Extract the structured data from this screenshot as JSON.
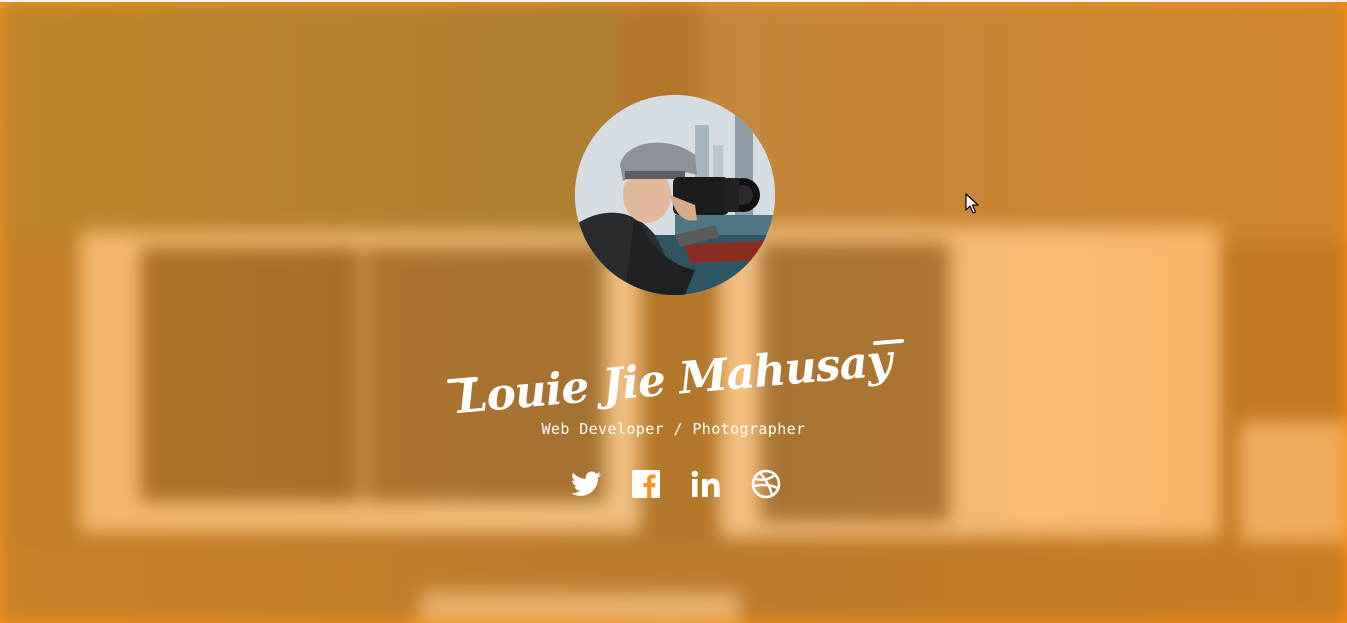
{
  "profile": {
    "name": "Louie Jie Mahusay",
    "subtitle": "Web Developer / Photographer",
    "avatar_icon": "photographer-portrait"
  },
  "social": [
    {
      "icon": "twitter-icon"
    },
    {
      "icon": "facebook-icon"
    },
    {
      "icon": "linkedin-icon"
    },
    {
      "icon": "dribbble-icon"
    }
  ],
  "colors": {
    "accent": "#f7931c",
    "text": "#ffffff"
  }
}
